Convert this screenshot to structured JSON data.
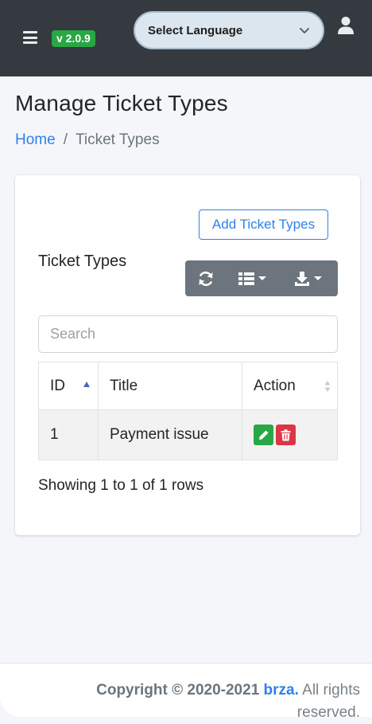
{
  "header": {
    "version_badge": "v 2.0.9",
    "language_select": "Select Language"
  },
  "page": {
    "title": "Manage Ticket Types",
    "breadcrumb": {
      "home": "Home",
      "separator": "/",
      "current": "Ticket Types"
    }
  },
  "card": {
    "add_button": "Add Ticket Types",
    "title": "Ticket Types",
    "search_placeholder": "Search",
    "table": {
      "columns": {
        "id": "ID",
        "title": "Title",
        "action": "Action"
      },
      "rows": [
        {
          "id": "1",
          "title": "Payment issue"
        }
      ]
    },
    "pagination_info": "Showing 1 to 1 of 1 rows"
  },
  "footer": {
    "copyright": "Copyright © 2020-2021",
    "brand": "brza.",
    "rights": "All rights reserved."
  },
  "colors": {
    "topbar": "#343a40",
    "version_badge": "#28a745",
    "link": "#2f80ed",
    "toolbar": "#6c757d",
    "edit": "#28a745",
    "delete": "#dc3545"
  },
  "icons": [
    "hamburger-icon",
    "chevron-down-icon",
    "user-icon",
    "refresh-icon",
    "columns-icon",
    "download-icon",
    "pencil-icon",
    "trash-icon",
    "sort-asc-icon",
    "sort-icon"
  ]
}
